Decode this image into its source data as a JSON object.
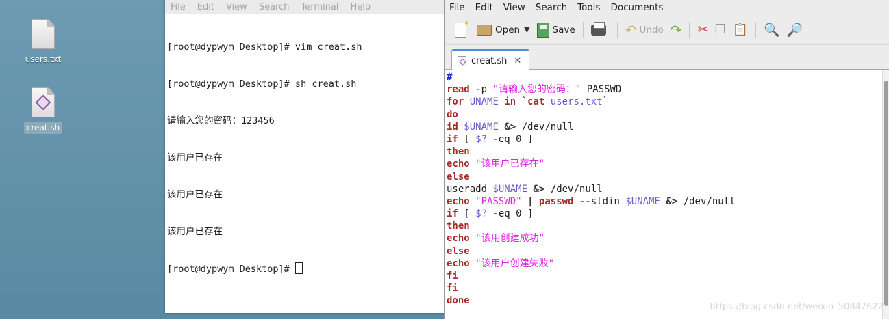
{
  "desktop": {
    "icons": [
      {
        "label": "users.txt",
        "type": "text-file-icon"
      },
      {
        "label": "creat.sh",
        "type": "script-file-icon"
      }
    ]
  },
  "terminal": {
    "menu": [
      "File",
      "Edit",
      "View",
      "Search",
      "Terminal",
      "Help"
    ],
    "lines": [
      "[root@dypwym Desktop]# vim creat.sh",
      "[root@dypwym Desktop]# sh creat.sh",
      "请输入您的密码：123456",
      "该用户已存在",
      "该用户已存在",
      "该用户已存在"
    ],
    "prompt": "[root@dypwym Desktop]# "
  },
  "gedit": {
    "menu": [
      "File",
      "Edit",
      "View",
      "Search",
      "Tools",
      "Documents"
    ],
    "toolbar": {
      "open": "Open",
      "save": "Save",
      "undo": "Undo"
    },
    "tab": {
      "label": "creat.sh",
      "close": "✕"
    },
    "code": [
      [
        {
          "t": "#",
          "c": "cmt"
        }
      ],
      [
        {
          "t": "read",
          "c": "kw"
        },
        {
          "t": " -p ",
          "c": "plain"
        },
        {
          "t": "\"请输入您的密码：\"",
          "c": "str"
        },
        {
          "t": " PASSWD",
          "c": "plain"
        }
      ],
      [
        {
          "t": "for",
          "c": "kw"
        },
        {
          "t": " ",
          "c": "plain"
        },
        {
          "t": "UNAME",
          "c": "var"
        },
        {
          "t": " ",
          "c": "plain"
        },
        {
          "t": "in",
          "c": "kw"
        },
        {
          "t": " `",
          "c": "plain"
        },
        {
          "t": "cat",
          "c": "kw"
        },
        {
          "t": " ",
          "c": "plain"
        },
        {
          "t": "users.txt",
          "c": "var"
        },
        {
          "t": "`",
          "c": "plain"
        }
      ],
      [
        {
          "t": "do",
          "c": "kw"
        }
      ],
      [
        {
          "t": "id",
          "c": "kw"
        },
        {
          "t": " ",
          "c": "plain"
        },
        {
          "t": "$UNAME",
          "c": "var"
        },
        {
          "t": " ",
          "c": "plain"
        },
        {
          "t": "&>",
          "c": "op"
        },
        {
          "t": " ",
          "c": "plain"
        },
        {
          "t": "/",
          "c": "op"
        },
        {
          "t": "dev",
          "c": "plain"
        },
        {
          "t": "/",
          "c": "op"
        },
        {
          "t": "null",
          "c": "plain"
        }
      ],
      [
        {
          "t": "if",
          "c": "kw"
        },
        {
          "t": " [ ",
          "c": "plain"
        },
        {
          "t": "$?",
          "c": "var"
        },
        {
          "t": " -eq 0 ]",
          "c": "plain"
        }
      ],
      [
        {
          "t": "then",
          "c": "kw"
        }
      ],
      [
        {
          "t": "echo",
          "c": "kw"
        },
        {
          "t": " ",
          "c": "plain"
        },
        {
          "t": "\"该用户已存在\"",
          "c": "str"
        }
      ],
      [
        {
          "t": "else",
          "c": "kw"
        }
      ],
      [
        {
          "t": "useradd ",
          "c": "plain"
        },
        {
          "t": "$UNAME",
          "c": "var"
        },
        {
          "t": " ",
          "c": "plain"
        },
        {
          "t": "&>",
          "c": "op"
        },
        {
          "t": " ",
          "c": "plain"
        },
        {
          "t": "/",
          "c": "op"
        },
        {
          "t": "dev",
          "c": "plain"
        },
        {
          "t": "/",
          "c": "op"
        },
        {
          "t": "null",
          "c": "plain"
        }
      ],
      [
        {
          "t": "echo",
          "c": "kw"
        },
        {
          "t": " ",
          "c": "plain"
        },
        {
          "t": "\"PASSWD\"",
          "c": "str"
        },
        {
          "t": " ",
          "c": "plain"
        },
        {
          "t": "|",
          "c": "op"
        },
        {
          "t": " ",
          "c": "plain"
        },
        {
          "t": "passwd",
          "c": "kw"
        },
        {
          "t": " --stdin ",
          "c": "plain"
        },
        {
          "t": "$UNAME",
          "c": "var"
        },
        {
          "t": " ",
          "c": "plain"
        },
        {
          "t": "&>",
          "c": "op"
        },
        {
          "t": " ",
          "c": "plain"
        },
        {
          "t": "/",
          "c": "op"
        },
        {
          "t": "dev",
          "c": "plain"
        },
        {
          "t": "/",
          "c": "op"
        },
        {
          "t": "null",
          "c": "plain"
        }
      ],
      [
        {
          "t": "if",
          "c": "kw"
        },
        {
          "t": " [ ",
          "c": "plain"
        },
        {
          "t": "$?",
          "c": "var"
        },
        {
          "t": " -eq 0 ]",
          "c": "plain"
        }
      ],
      [
        {
          "t": "then",
          "c": "kw"
        }
      ],
      [
        {
          "t": "echo",
          "c": "kw"
        },
        {
          "t": " ",
          "c": "plain"
        },
        {
          "t": "\"该用创建成功\"",
          "c": "str"
        }
      ],
      [
        {
          "t": "else",
          "c": "kw"
        }
      ],
      [
        {
          "t": "echo",
          "c": "kw"
        },
        {
          "t": " ",
          "c": "plain"
        },
        {
          "t": "\"该用户创建失败\"",
          "c": "str"
        }
      ],
      [
        {
          "t": "fi",
          "c": "kw"
        }
      ],
      [
        {
          "t": "fi",
          "c": "kw"
        }
      ],
      [
        {
          "t": "done",
          "c": "kw"
        }
      ]
    ]
  },
  "watermark": "https://blog.csdn.net/weixin_50847622",
  "colors": {
    "keyword": "#a52a2a",
    "string": "#e222e2",
    "variable": "#6a5acd",
    "comment": "#1b1bd0",
    "tab_accent": "#4a90d9"
  }
}
